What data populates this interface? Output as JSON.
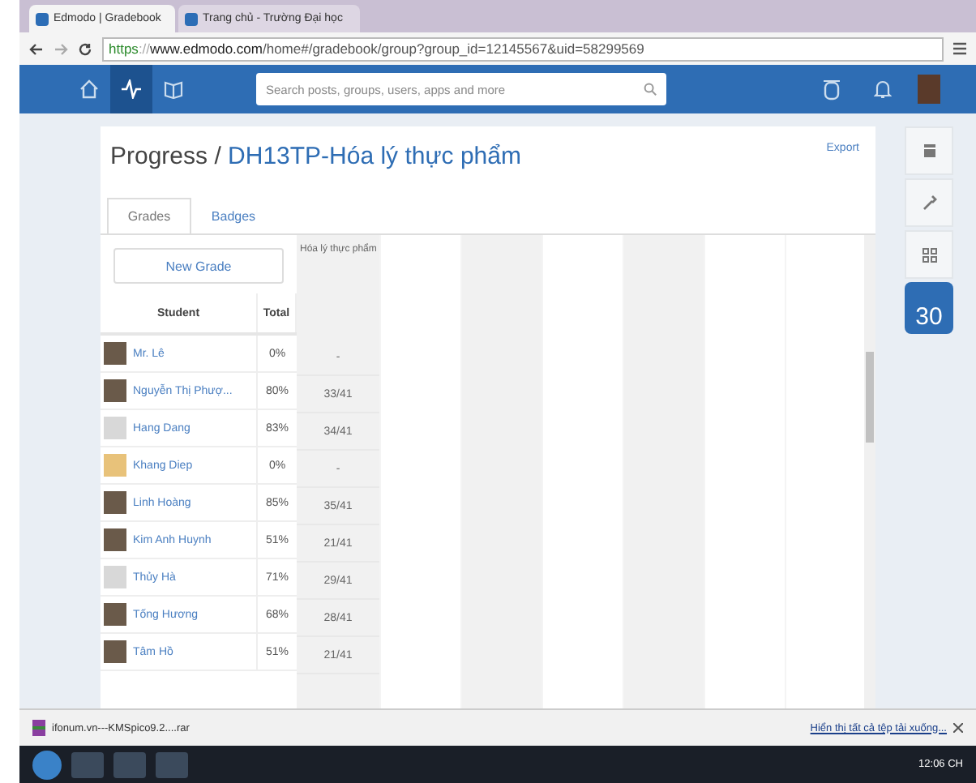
{
  "browser": {
    "tabs": [
      {
        "label": "Edmodo | Gradebook",
        "selected": true
      },
      {
        "label": "Trang chủ - Trường Đại học",
        "selected": false
      }
    ],
    "url": {
      "scheme": "https",
      "separator": "://",
      "host": "www.edmodo.com",
      "path": "/home#/gradebook/group?group_id=12145567&uid=58299569"
    }
  },
  "nav": {
    "items": [
      {
        "kind": "home",
        "selected": false
      },
      {
        "kind": "progress",
        "selected": true
      },
      {
        "kind": "library",
        "selected": false
      }
    ],
    "search": {
      "placeholder": "Search posts, groups, users, apps and more"
    }
  },
  "page": {
    "title": "Progress /",
    "group": "DH13TP-Hóa lý thực phẩm",
    "export": "Export",
    "tabs": [
      {
        "label": "Grades",
        "selected": true
      },
      {
        "label": "Badges",
        "selected": false
      }
    ],
    "new_grade": "New Grade",
    "columns": {
      "student": "Student",
      "total": "Total",
      "grade": "Hóa lý thực phẩm"
    },
    "rows": [
      {
        "name": "Mr. Lê",
        "total": "0%",
        "grade": "-",
        "kind": "photo"
      },
      {
        "name": "Nguyễn Thị Phượ...",
        "total": "80%",
        "grade": "33/41",
        "kind": "photo"
      },
      {
        "name": "Hang Dang",
        "total": "83%",
        "grade": "34/41",
        "kind": "default"
      },
      {
        "name": "Khang Diep",
        "total": "0%",
        "grade": "-",
        "kind": "cartoon"
      },
      {
        "name": "Linh Hoàng",
        "total": "85%",
        "grade": "35/41",
        "kind": "photo"
      },
      {
        "name": "Kim Anh Huynh",
        "total": "51%",
        "grade": "21/41",
        "kind": "photo"
      },
      {
        "name": "Thủy Hà",
        "total": "71%",
        "grade": "29/41",
        "kind": "default"
      },
      {
        "name": "Tống Hương",
        "total": "68%",
        "grade": "28/41",
        "kind": "photo"
      },
      {
        "name": "Tâm Hồ",
        "total": "51%",
        "grade": "21/41",
        "kind": "photo"
      }
    ]
  },
  "side": {
    "calendar_day": "30"
  },
  "downloads": {
    "file": "ifonum.vn---KMSpico9.2....rar",
    "show_all": "Hiển thị tất cả tệp tải xuống..."
  },
  "taskbar": {
    "clock": "12:06 CH"
  }
}
